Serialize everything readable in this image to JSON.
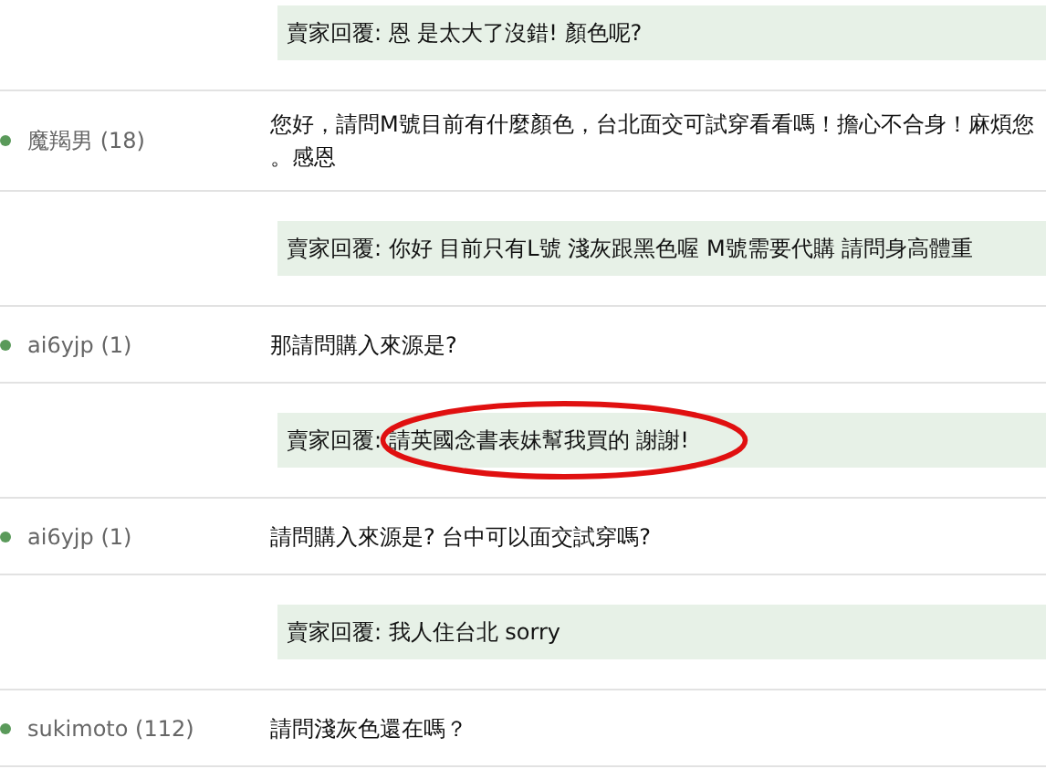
{
  "entries": [
    {
      "kind": "reply",
      "text": "賣家回覆: 恩 是太大了沒錯! 顏色呢?",
      "circled": false
    },
    {
      "kind": "question",
      "user": "魔羯男 (18)",
      "lines": [
        "您好，請問M號目前有什麼顏色，台北面交可試穿看看嗎！擔心不合身！麻煩您",
        "。感恩"
      ]
    },
    {
      "kind": "reply",
      "text": "賣家回覆: 你好 目前只有L號 淺灰跟黑色喔 M號需要代購 請問身高體重",
      "circled": false
    },
    {
      "kind": "question",
      "user": "ai6yjp (1)",
      "lines": [
        "那請問購入來源是?"
      ]
    },
    {
      "kind": "reply",
      "text": "賣家回覆: 請英國念書表妹幫我買的 謝謝!",
      "circled": true
    },
    {
      "kind": "question",
      "user": "ai6yjp (1)",
      "lines": [
        "請問購入來源是? 台中可以面交試穿嗎?"
      ]
    },
    {
      "kind": "reply",
      "text": "賣家回覆: 我人住台北 sorry",
      "circled": false
    },
    {
      "kind": "question",
      "user": "sukimoto (112)",
      "lines": [
        "請問淺灰色還在嗎？"
      ]
    }
  ]
}
